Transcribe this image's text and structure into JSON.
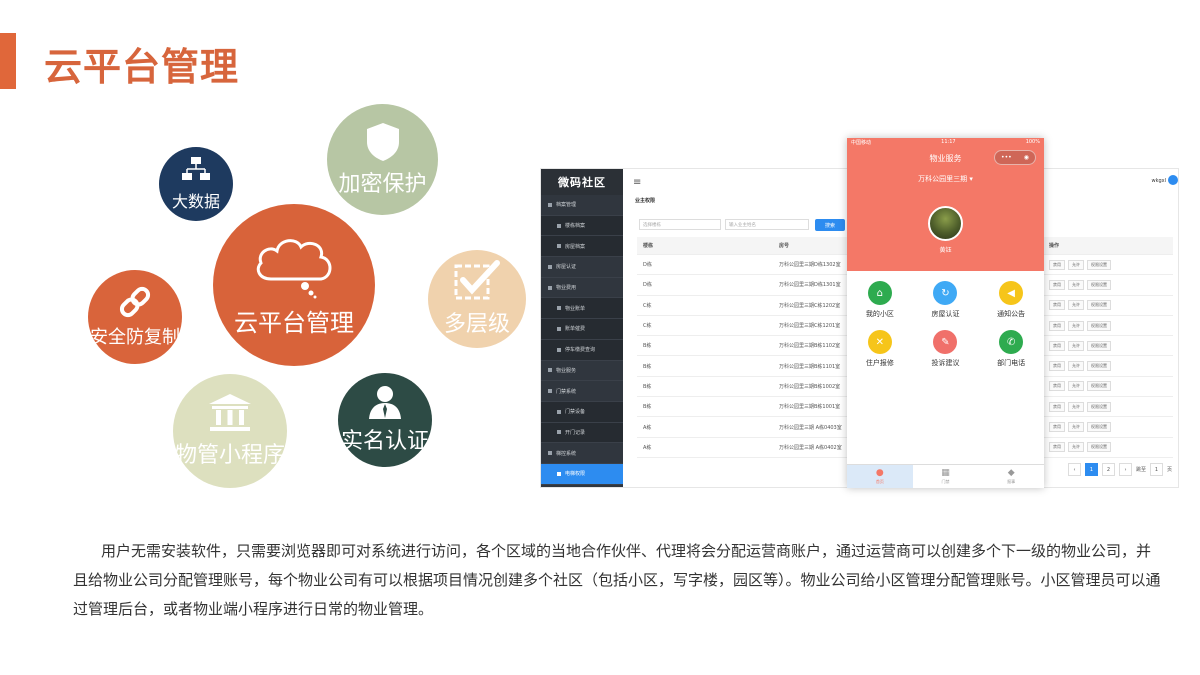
{
  "title": "云平台管理",
  "circles": {
    "bigdata": {
      "label": "大数据",
      "icon": "network-computers-icon"
    },
    "encrypt": {
      "label": "加密保护",
      "icon": "shield-icon"
    },
    "multilevel": {
      "label": "多层级",
      "icon": "checkbox-icon"
    },
    "realname": {
      "label": "实名认证",
      "icon": "person-icon"
    },
    "miniapp": {
      "label": "物管小程序",
      "icon": "bank-building-icon"
    },
    "anticopy": {
      "label": "安全防复制",
      "icon": "link-icon"
    },
    "cloud": {
      "label": "云平台管理",
      "icon": "cloud-icon"
    }
  },
  "admin": {
    "brand": "微码社区",
    "page_title": "业主权限",
    "user": "wkgxl",
    "filter1_placeholder": "选择楼栋",
    "filter2_placeholder": "输入业主姓名",
    "search_label": "搜索",
    "sidebar": [
      {
        "label": "档案管理",
        "sub": false,
        "active": false
      },
      {
        "label": "楼栋档案",
        "sub": true,
        "active": false
      },
      {
        "label": "房屋档案",
        "sub": true,
        "active": false
      },
      {
        "label": "房屋认证",
        "sub": false,
        "active": false
      },
      {
        "label": "物业费用",
        "sub": false,
        "active": false
      },
      {
        "label": "物业账单",
        "sub": true,
        "active": false
      },
      {
        "label": "账单催费",
        "sub": true,
        "active": false
      },
      {
        "label": "停车缴费查询",
        "sub": true,
        "active": false
      },
      {
        "label": "物业服务",
        "sub": false,
        "active": false
      },
      {
        "label": "门禁系统",
        "sub": false,
        "active": false
      },
      {
        "label": "门禁设备",
        "sub": true,
        "active": false
      },
      {
        "label": "开门记录",
        "sub": true,
        "active": false
      },
      {
        "label": "梯控系统",
        "sub": false,
        "active": false
      },
      {
        "label": "电梯权限",
        "sub": true,
        "active": true
      }
    ],
    "columns": [
      "楼栋",
      "房号",
      "操作"
    ],
    "rows": [
      {
        "building": "D栋",
        "room": "万科公园里三期D栋1302室"
      },
      {
        "building": "D栋",
        "room": "万科公园里三期D栋1301室"
      },
      {
        "building": "C栋",
        "room": "万科公园里三期C栋1202室"
      },
      {
        "building": "C栋",
        "room": "万科公园里三期C栋1201室"
      },
      {
        "building": "B栋",
        "room": "万科公园里三期B栋1102室"
      },
      {
        "building": "B栋",
        "room": "万科公园里三期B栋1101室"
      },
      {
        "building": "B栋",
        "room": "万科公园里三期B栋1002室"
      },
      {
        "building": "B栋",
        "room": "万科公园里三期B栋1001室"
      },
      {
        "building": "A栋",
        "room": "万科公园里三期 A栋0403室"
      },
      {
        "building": "A栋",
        "room": "万科公园里三期 A栋0402室"
      }
    ],
    "row_actions": [
      "禁用",
      "允许",
      "权限设置"
    ],
    "pager": {
      "prev": "‹",
      "pages": [
        "1",
        "2"
      ],
      "next": "›",
      "goto": "跳至",
      "input": "1",
      "unit": "页"
    }
  },
  "phone": {
    "carrier": "中国移动",
    "time": "11:17",
    "battery": "100%",
    "title": "物业服务",
    "capsule": [
      "•••",
      "◉"
    ],
    "community": "万科公园里三期 ▾",
    "user_name": "黄钰",
    "grid": [
      {
        "label": "我的小区",
        "color": "#2eab4f",
        "icon": "home-icon",
        "glyph": "⌂"
      },
      {
        "label": "房屋认证",
        "color": "#3fa9f5",
        "icon": "refresh-icon",
        "glyph": "↻"
      },
      {
        "label": "通知公告",
        "color": "#f6c51a",
        "icon": "speaker-icon",
        "glyph": "◀"
      },
      {
        "label": "住户报修",
        "color": "#f6c51a",
        "icon": "wrench-icon",
        "glyph": "✕"
      },
      {
        "label": "投诉建议",
        "color": "#f0706a",
        "icon": "edit-icon",
        "glyph": "✎"
      },
      {
        "label": "部门电话",
        "color": "#2eab4f",
        "icon": "phone-icon",
        "glyph": "✆"
      }
    ],
    "tabs": [
      {
        "label": "首页",
        "icon": "user-circle-icon",
        "glyph": "●"
      },
      {
        "label": "门禁",
        "icon": "qr-icon",
        "glyph": "▦"
      },
      {
        "label": "报事",
        "icon": "drop-icon",
        "glyph": "◆"
      }
    ]
  },
  "paragraph": "用户无需安装软件，只需要浏览器即可对系统进行访问，各个区域的当地合作伙伴、代理将会分配运营商账户，通过运营商可以创建多个下一级的物业公司，并且给物业公司分配管理账号，每个物业公司有可以根据项目情况创建多个社区（包括小区，写字楼，园区等）。物业公司给小区管理分配管理账号。小区管理员可以通过管理后台，或者物业端小程序进行日常的物业管理。"
}
